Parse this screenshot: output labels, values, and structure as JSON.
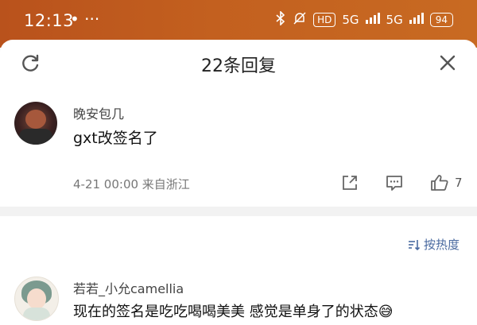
{
  "status_bar": {
    "time": "12:13",
    "left_icons": "• ···",
    "hd_label": "HD",
    "signal1_label": "5G",
    "signal2_label": "5G",
    "battery_label": "94"
  },
  "sheet": {
    "title": "22条回复",
    "refresh_icon": "refresh-icon",
    "close_icon": "close-icon"
  },
  "main_comment": {
    "author": "晚安包几",
    "text": "gxt改签名了",
    "meta": "4-21 00:00 来自浙江",
    "like_count": "7",
    "icons": [
      "share-icon",
      "reply-icon",
      "like-icon"
    ]
  },
  "sort": {
    "label": "按热度",
    "icon": "sort-icon"
  },
  "reply": {
    "author": "若若_小允camellia",
    "text": "现在的签名是吃吃喝喝美美 感觉是单身了的状态😅"
  },
  "colors": {
    "status_bar": "#c3601f",
    "sort_link": "#4a6aa0",
    "divider": "#f2f2f2"
  }
}
